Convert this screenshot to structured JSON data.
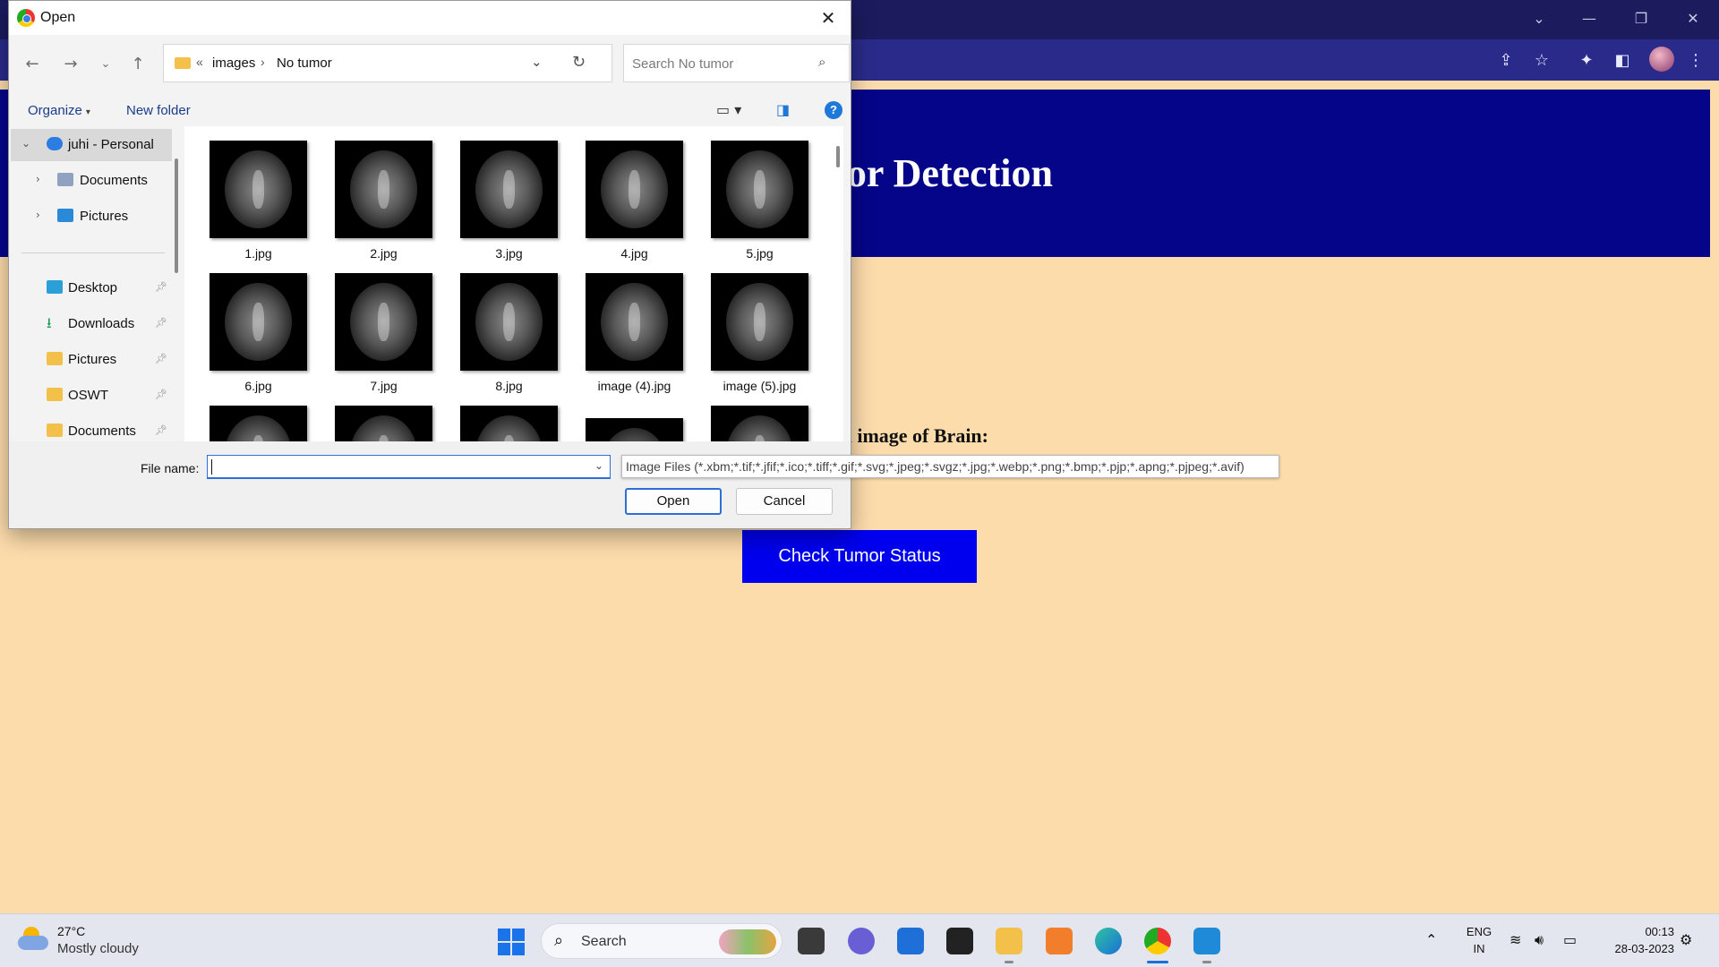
{
  "page": {
    "banner_title": "Brain Tumor Detection",
    "upload_label": "Upload an image of Brain:",
    "check_button": "Check Tumor Status"
  },
  "dialog": {
    "title": "Open",
    "breadcrumb": {
      "overflow": "«",
      "items": [
        "images",
        "No tumor"
      ]
    },
    "search_placeholder": "Search No tumor",
    "commands": {
      "organize": "Organize",
      "new_folder": "New folder"
    },
    "nav": {
      "account": "juhi - Personal",
      "tree": [
        "Documents",
        "Pictures"
      ],
      "quick_access": [
        "Desktop",
        "Downloads",
        "Pictures",
        "OSWT",
        "Documents"
      ]
    },
    "files": [
      "1.jpg",
      "2.jpg",
      "3.jpg",
      "4.jpg",
      "5.jpg",
      "6.jpg",
      "7.jpg",
      "8.jpg",
      "image (4).jpg",
      "image (5).jpg"
    ],
    "file_name_label": "File name:",
    "file_name_value": "",
    "file_type": "Image Files (*.xbm;*.tif;*.jfif;*.ico;*.tiff;*.gif;*.svg;*.jpeg;*.svgz;*.jpg;*.webp;*.png;*.bmp;*.pjp;*.apng;*.pjpeg;*.avif)",
    "open_button": "Open",
    "cancel_button": "Cancel"
  },
  "taskbar": {
    "weather_temp": "27°C",
    "weather_desc": "Mostly cloudy",
    "search_label": "Search",
    "lang_top": "ENG",
    "lang_bottom": "IN",
    "time": "00:13",
    "date": "28-03-2023"
  },
  "colors": {
    "page_bg": "#fcdcab",
    "banner_bg": "#05058a",
    "button_bg": "#0000ee",
    "chrome_bg": "#1b1b5e"
  }
}
